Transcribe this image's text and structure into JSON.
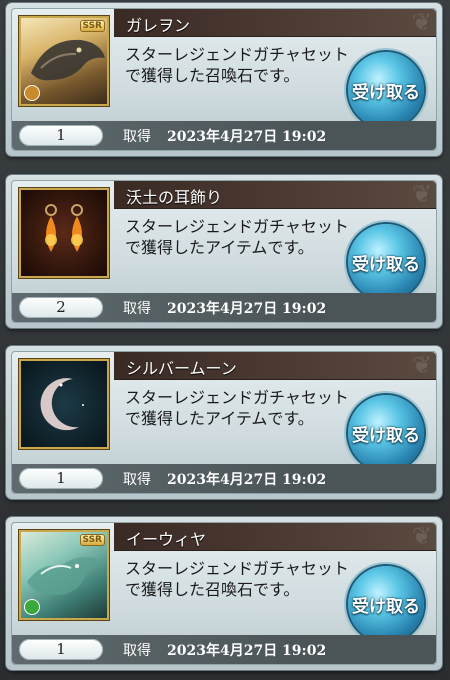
{
  "acquired_label": "取得",
  "claim_label": "受け取る",
  "items": [
    {
      "name": "ガレヲン",
      "description": "スターレジェンドガチャセットで獲得した召喚石です。",
      "quantity": "1",
      "date": "2023年4月27日 19:02",
      "rarity_badge": "SSR",
      "thumbnail": "galleon-summon-art",
      "element_color": "#c88a2a"
    },
    {
      "name": "沃土の耳飾り",
      "description": "スターレジェンドガチャセットで獲得したアイテムです。",
      "quantity": "2",
      "date": "2023年4月27日 19:02",
      "rarity_badge": "",
      "thumbnail": "earrings-item-art",
      "element_color": ""
    },
    {
      "name": "シルバームーン",
      "description": "スターレジェンドガチャセットで獲得したアイテムです。",
      "quantity": "1",
      "date": "2023年4月27日 19:02",
      "rarity_badge": "",
      "thumbnail": "silver-moon-item-art",
      "element_color": ""
    },
    {
      "name": "イーウィヤ",
      "description": "スターレジェンドガチャセットで獲得した召喚石です。",
      "quantity": "1",
      "date": "2023年4月27日 19:02",
      "rarity_badge": "SSR",
      "thumbnail": "iwiya-summon-art",
      "element_color": "#3aa83a"
    }
  ]
}
